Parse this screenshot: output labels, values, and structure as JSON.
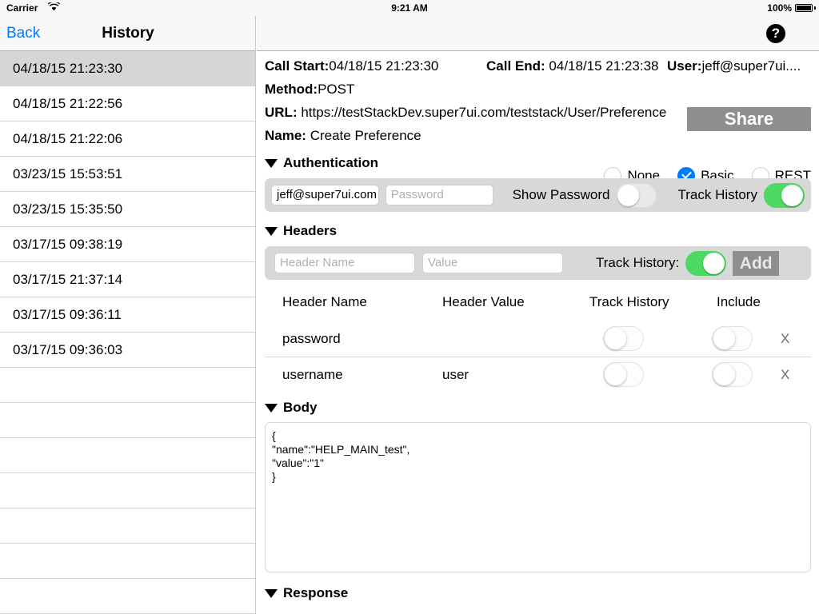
{
  "statusbar": {
    "carrier": "Carrier",
    "wifi_icon": "wifi-icon",
    "time": "9:21 AM",
    "battery_percent": "100%",
    "battery_icon": "battery-full-icon"
  },
  "sidebar": {
    "back_label": "Back",
    "title": "History",
    "items": [
      {
        "label": "04/18/15 21:23:30",
        "selected": true
      },
      {
        "label": "04/18/15 21:22:56",
        "selected": false
      },
      {
        "label": "04/18/15 21:22:06",
        "selected": false
      },
      {
        "label": "03/23/15 15:53:51",
        "selected": false
      },
      {
        "label": "03/23/15 15:35:50",
        "selected": false
      },
      {
        "label": "03/17/15 09:38:19",
        "selected": false
      },
      {
        "label": "03/17/15 21:37:14",
        "selected": false
      },
      {
        "label": "03/17/15 09:36:11",
        "selected": false
      },
      {
        "label": "03/17/15 09:36:03",
        "selected": false
      },
      {
        "label": "",
        "selected": false
      },
      {
        "label": "",
        "selected": false
      },
      {
        "label": "",
        "selected": false
      },
      {
        "label": "",
        "selected": false
      },
      {
        "label": "",
        "selected": false
      },
      {
        "label": "",
        "selected": false
      },
      {
        "label": "",
        "selected": false
      }
    ]
  },
  "detail": {
    "help_icon": "question-mark-icon",
    "call_start_label": "Call Start:",
    "call_start_value": "04/18/15 21:23:30",
    "call_end_label": "Call End:",
    "call_end_value": "04/18/15 21:23:38",
    "user_label": "User:",
    "user_value": "jeff@super7ui....",
    "method_label": "Method:",
    "method_value": "POST",
    "url_label": "URL:",
    "url_value": "https://testStackDev.super7ui.com/teststack/User/Preference",
    "name_label": "Name:",
    "name_value": "Create Preference",
    "share_label": "Share"
  },
  "authentication": {
    "section_title": "Authentication",
    "options": [
      {
        "label": "None",
        "selected": false
      },
      {
        "label": "Basic",
        "selected": true
      },
      {
        "label": "REST",
        "selected": false
      }
    ],
    "username_value": "jeff@super7ui.com",
    "password_placeholder": "Password",
    "show_password_label": "Show Password",
    "show_password_on": false,
    "track_history_label": "Track History",
    "track_history_on": true
  },
  "headers": {
    "section_title": "Headers",
    "name_placeholder": "Header Name",
    "value_placeholder": "Value",
    "track_history_label": "Track History:",
    "track_history_on": true,
    "add_label": "Add",
    "columns": {
      "name": "Header Name",
      "value": "Header Value",
      "track": "Track History",
      "include": "Include"
    },
    "delete_label": "X",
    "rows": [
      {
        "name": "password",
        "value": "",
        "track_on": false,
        "include_on": false
      },
      {
        "name": "username",
        "value": "user",
        "track_on": false,
        "include_on": false
      }
    ]
  },
  "body": {
    "section_title": "Body",
    "content": "{\n\"name\":\"HELP_MAIN_test\",\n\"value\":\"1\"\n}"
  },
  "response": {
    "section_title": "Response"
  },
  "colors": {
    "accent_blue": "#007aff",
    "toggle_green": "#4cd964",
    "share_gray": "#8e8e8e",
    "selected_row": "#d6d6d6"
  }
}
